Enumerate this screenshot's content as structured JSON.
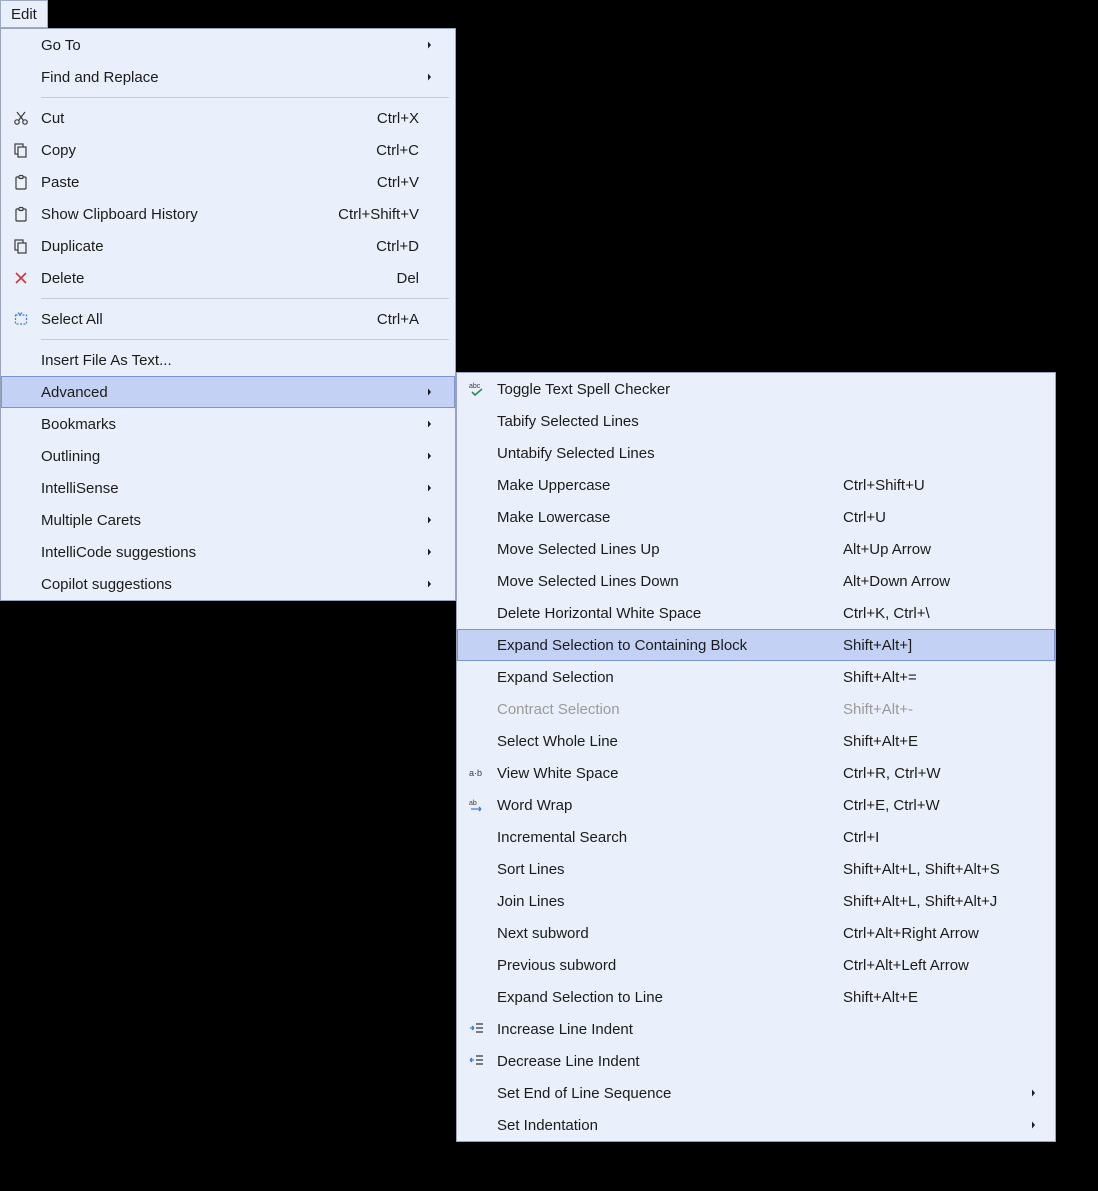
{
  "menubar": {
    "edit": "Edit"
  },
  "main_menu": [
    {
      "id": "goto",
      "label": "Go To",
      "submenu": true
    },
    {
      "id": "findreplace",
      "label": "Find and Replace",
      "submenu": true
    },
    {
      "sep": true
    },
    {
      "id": "cut",
      "label": "Cut",
      "shortcut": "Ctrl+X",
      "icon": "cut"
    },
    {
      "id": "copy",
      "label": "Copy",
      "shortcut": "Ctrl+C",
      "icon": "copy"
    },
    {
      "id": "paste",
      "label": "Paste",
      "shortcut": "Ctrl+V",
      "icon": "paste"
    },
    {
      "id": "clipboardhistory",
      "label": "Show Clipboard History",
      "shortcut": "Ctrl+Shift+V",
      "icon": "paste"
    },
    {
      "id": "duplicate",
      "label": "Duplicate",
      "shortcut": "Ctrl+D",
      "icon": "copy"
    },
    {
      "id": "delete",
      "label": "Delete",
      "shortcut": "Del",
      "icon": "delete"
    },
    {
      "sep": true
    },
    {
      "id": "selectall",
      "label": "Select All",
      "shortcut": "Ctrl+A",
      "icon": "selectall"
    },
    {
      "sep": true
    },
    {
      "id": "insertfile",
      "label": "Insert File As Text..."
    },
    {
      "id": "advanced",
      "label": "Advanced",
      "submenu": true,
      "highlight": true
    },
    {
      "id": "bookmarks",
      "label": "Bookmarks",
      "submenu": true
    },
    {
      "id": "outlining",
      "label": "Outlining",
      "submenu": true
    },
    {
      "id": "intellisense",
      "label": "IntelliSense",
      "submenu": true
    },
    {
      "id": "multiplecarets",
      "label": "Multiple Carets",
      "submenu": true
    },
    {
      "id": "intellicodesuggestions",
      "label": "IntelliCode suggestions",
      "submenu": true
    },
    {
      "id": "copilotsuggestions",
      "label": "Copilot suggestions",
      "submenu": true
    }
  ],
  "sub_menu": [
    {
      "id": "spellchecker",
      "label": "Toggle Text Spell Checker",
      "icon": "abc-check"
    },
    {
      "id": "tabify",
      "label": "Tabify Selected Lines"
    },
    {
      "id": "untabify",
      "label": "Untabify Selected Lines"
    },
    {
      "id": "uppercase",
      "label": "Make Uppercase",
      "shortcut": "Ctrl+Shift+U"
    },
    {
      "id": "lowercase",
      "label": "Make Lowercase",
      "shortcut": "Ctrl+U"
    },
    {
      "id": "moveup",
      "label": "Move Selected Lines Up",
      "shortcut": "Alt+Up Arrow"
    },
    {
      "id": "movedown",
      "label": "Move Selected Lines Down",
      "shortcut": "Alt+Down Arrow"
    },
    {
      "id": "deletehws",
      "label": "Delete Horizontal White Space",
      "shortcut": "Ctrl+K, Ctrl+\\"
    },
    {
      "id": "expandblock",
      "label": "Expand Selection to Containing Block",
      "shortcut": "Shift+Alt+]",
      "highlight": true
    },
    {
      "id": "expandsel",
      "label": "Expand Selection",
      "shortcut": "Shift+Alt+="
    },
    {
      "id": "contractsel",
      "label": "Contract Selection",
      "shortcut": "Shift+Alt+-",
      "disabled": true
    },
    {
      "id": "selwholeline",
      "label": "Select Whole Line",
      "shortcut": "Shift+Alt+E"
    },
    {
      "id": "viewws",
      "label": "View White Space",
      "shortcut": "Ctrl+R, Ctrl+W",
      "icon": "adotb"
    },
    {
      "id": "wordwrap",
      "label": "Word Wrap",
      "shortcut": "Ctrl+E, Ctrl+W",
      "icon": "wordwrap"
    },
    {
      "id": "incsearch",
      "label": "Incremental Search",
      "shortcut": "Ctrl+I"
    },
    {
      "id": "sortlines",
      "label": "Sort Lines",
      "shortcut": "Shift+Alt+L, Shift+Alt+S"
    },
    {
      "id": "joinlines",
      "label": "Join Lines",
      "shortcut": "Shift+Alt+L, Shift+Alt+J"
    },
    {
      "id": "nextsubword",
      "label": "Next subword",
      "shortcut": "Ctrl+Alt+Right Arrow"
    },
    {
      "id": "prevsubword",
      "label": "Previous subword",
      "shortcut": "Ctrl+Alt+Left Arrow"
    },
    {
      "id": "expandtoline",
      "label": "Expand Selection to Line",
      "shortcut": "Shift+Alt+E"
    },
    {
      "id": "increaseindent",
      "label": "Increase Line Indent",
      "icon": "indent"
    },
    {
      "id": "decreaseindent",
      "label": "Decrease Line Indent",
      "icon": "outdent"
    },
    {
      "id": "eolseq",
      "label": "Set End of Line Sequence",
      "submenu": true
    },
    {
      "id": "setindentation",
      "label": "Set Indentation",
      "submenu": true
    }
  ]
}
